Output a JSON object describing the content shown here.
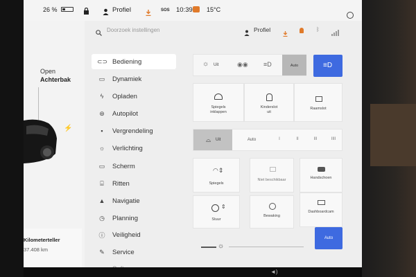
{
  "status_bar": {
    "battery_percent": "26 %",
    "profile_label": "Profiel",
    "sos_label": "SOS",
    "time": "10:39",
    "temperature": "15°C"
  },
  "car": {
    "trunk_line1": "Open",
    "trunk_line2": "Achterbak",
    "odometer_label": "Kilometerteller",
    "odometer_value": "37.408 km"
  },
  "search": {
    "placeholder": "Doorzoek instellingen",
    "profile_label": "Profiel"
  },
  "sidebar": {
    "items": [
      {
        "label": "Bediening",
        "icon": "toggle-icon"
      },
      {
        "label": "Dynamiek",
        "icon": "car-icon"
      },
      {
        "label": "Opladen",
        "icon": "bolt-icon"
      },
      {
        "label": "Autopilot",
        "icon": "steering-wheel-icon"
      },
      {
        "label": "Vergrendeling",
        "icon": "lock-icon"
      },
      {
        "label": "Verlichting",
        "icon": "sun-icon"
      },
      {
        "label": "Scherm",
        "icon": "display-icon"
      },
      {
        "label": "Ritten",
        "icon": "map-icon"
      },
      {
        "label": "Navigatie",
        "icon": "navigation-icon"
      },
      {
        "label": "Planning",
        "icon": "clock-icon"
      },
      {
        "label": "Veiligheid",
        "icon": "info-icon"
      },
      {
        "label": "Service",
        "icon": "wrench-icon"
      },
      {
        "label": "Software",
        "icon": "download-icon"
      }
    ]
  },
  "lights": {
    "off_label": "Uit",
    "auto_label": "Auto"
  },
  "mirrors": {
    "fold_label_1": "Spiegels",
    "fold_label_2": "inklappen",
    "child_lock_label_1": "Kinderslot",
    "child_lock_label_2": "uit",
    "window_lock_label": "Raamslot"
  },
  "wipers": {
    "off_label": "Uit",
    "auto_label": "Auto",
    "speeds": [
      "I",
      "II",
      "III",
      "IIII"
    ]
  },
  "adjust": {
    "mirrors_label": "Spiegels",
    "not_available_label": "Niet beschikbaar",
    "glovebox_label": "Handschoen",
    "steering_label": "Stuur",
    "pedals_label": "Bewaking",
    "dashcam_label": "Dashboardcam"
  },
  "brightness": {
    "auto_label": "Auto"
  },
  "colors": {
    "accent": "#3e6ae0",
    "orange": "#e07a2a"
  }
}
